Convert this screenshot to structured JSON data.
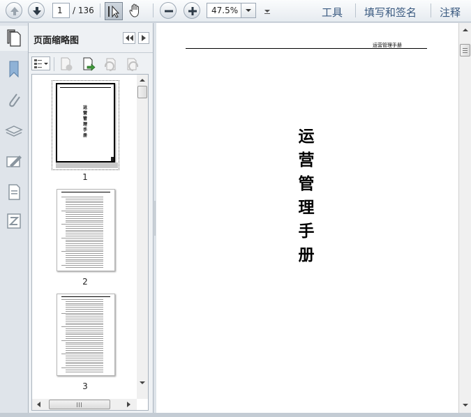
{
  "toolbar": {
    "page_current": "1",
    "page_total": "/ 136",
    "zoom_value": "47.5%",
    "tools_label": "工具",
    "fill_sign_label": "填写和签名",
    "comment_label": "注释"
  },
  "sidebar": {
    "title": "页面缩略图",
    "thumbnails": [
      {
        "number": "1"
      },
      {
        "number": "2"
      },
      {
        "number": "3"
      }
    ],
    "thumb1_title": "运营管理手册"
  },
  "document": {
    "header_text": "运营管理手册",
    "title_chars": [
      "运",
      "营",
      "管",
      "理",
      "手",
      "册"
    ]
  },
  "colors": {
    "accent_text": "#3a5a80",
    "toolbar_bg": "#e6ebf0",
    "panel_bg": "#eef1f4"
  }
}
